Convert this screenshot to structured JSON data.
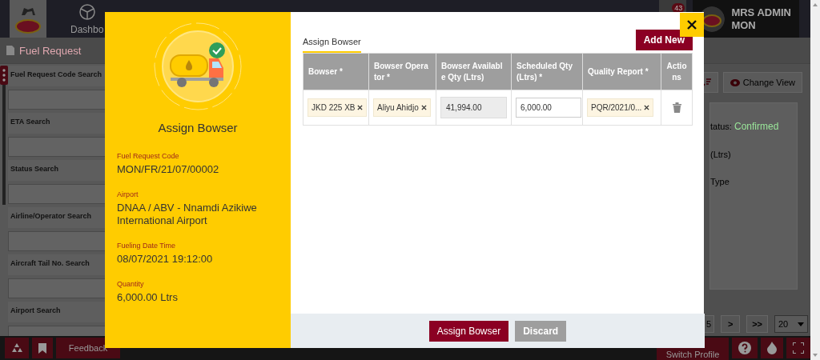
{
  "app": {
    "nav_label": "Dashbo",
    "notification_count": "43",
    "user_name": "MRS ADMIN",
    "user_sub": "MON",
    "page_title": "Fuel Request"
  },
  "filters": [
    {
      "label": "Fuel Request Code Search"
    },
    {
      "label": "ETA Search"
    },
    {
      "label": "Status Search"
    },
    {
      "label": "Airline/Operator Search"
    },
    {
      "label": "Aircraft Tail No. Search"
    },
    {
      "label": "Airport Search"
    }
  ],
  "toolbar": {
    "change_view": "Change View"
  },
  "detail_card": {
    "status_label": "tatus:",
    "status_value": "Confirmed",
    "line_2": "(Ltrs)",
    "line_3": "Type"
  },
  "pagination": {
    "page": "5",
    "next": ">",
    "last": ">>",
    "page_size": "20"
  },
  "footer": {
    "feedback": "Feedback",
    "switch_profile": "Switch Profile"
  },
  "modal": {
    "title": "Assign Bowser",
    "details": [
      {
        "label": "Fuel Request Code",
        "value": "MON/FR/21/07/00002"
      },
      {
        "label": "Airport",
        "value": "DNAA / ABV - Nnamdi Azikiwe International Airport"
      },
      {
        "label": "Fueling Date Time",
        "value": "08/07/2021 19:12:00"
      },
      {
        "label": "Quantity",
        "value": "6,000.00 Ltrs"
      }
    ],
    "tab": "Assign Bowser",
    "add_button": "Add New",
    "columns": [
      "Bowser *",
      "Bowser Operator *",
      "Bowser Available Qty (Ltrs)",
      "Scheduled Qty (Ltrs) *",
      "Quality Report *",
      "Actions"
    ],
    "rows": [
      {
        "cells": [
          {
            "kind": "chip",
            "text": "JKD 225 XB"
          },
          {
            "kind": "chip",
            "text": "Aliyu Ahidjo"
          },
          {
            "kind": "readonly",
            "text": "41,994.00"
          },
          {
            "kind": "input",
            "text": "6,000.00"
          },
          {
            "kind": "chip",
            "text": "PQR/2021/0..."
          },
          {
            "kind": "delete"
          }
        ]
      }
    ],
    "buttons": [
      {
        "label": "Assign Bowser",
        "kind": "primary"
      },
      {
        "label": "Discard",
        "kind": "secondary"
      }
    ]
  }
}
